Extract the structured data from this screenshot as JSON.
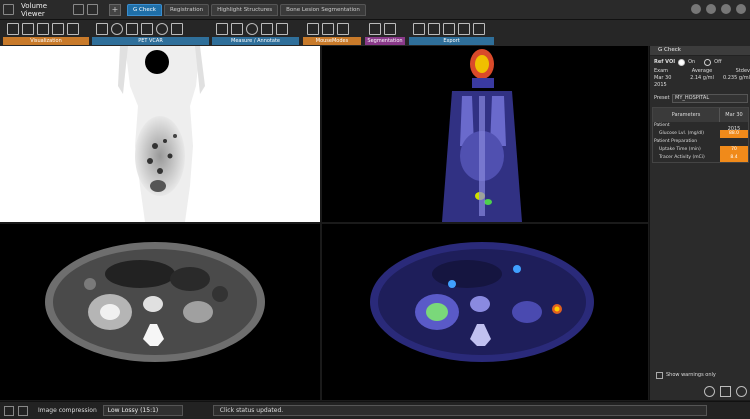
{
  "window": {
    "title": "Volume Viewer"
  },
  "tabs": [
    {
      "label": "G Check",
      "active": true
    },
    {
      "label": "Registration",
      "active": false
    },
    {
      "label": "Highlight Structures",
      "active": false
    },
    {
      "label": "Bone Lesion Segmentation",
      "active": false
    }
  ],
  "toolbar": {
    "groups": [
      {
        "label": "Visualization",
        "color": "#c87a2a"
      },
      {
        "label": "PET VCAR",
        "color": "#2f6f9a"
      },
      {
        "label": "Measure / Annotate",
        "color": "#2f6f9a"
      },
      {
        "label": "MouseModes",
        "color": "#c87a2a"
      },
      {
        "label": "Segmentation",
        "color": "#8a3a8a"
      },
      {
        "label": "Export",
        "color": "#2f6f9a"
      }
    ]
  },
  "panel": {
    "title": "G Check",
    "ref_voi_label": "Ref VOI",
    "on_label": "On",
    "off_label": "Off",
    "cols": [
      "Exam",
      "Average",
      "Stdev"
    ],
    "exam_date": "Mar 30 2015",
    "average": "2.14 g/ml",
    "stdev": "0.235 g/ml",
    "preset_label": "Preset",
    "preset_value": "MY_HOSPITAL",
    "table_headers": [
      "Parameters",
      "Mar 30 2015"
    ],
    "rows": [
      {
        "label": "Patient",
        "value": "",
        "orange": false,
        "section": true
      },
      {
        "label": "Glucose Lvl. (mg/dl)",
        "value": "88.0",
        "orange": true,
        "section": false
      },
      {
        "label": "Patient Preparation",
        "value": "",
        "orange": false,
        "section": true
      },
      {
        "label": "Uptake Time (min)",
        "value": "70",
        "orange": true,
        "section": false
      },
      {
        "label": "Tracer Activity (mCi)",
        "value": "8.4",
        "orange": true,
        "section": false
      }
    ],
    "show_warnings_label": "Show warnings only"
  },
  "status": {
    "compression_label": "Image compression",
    "compression_value": "Low Lossy (15:1)",
    "message": "Click status updated."
  }
}
